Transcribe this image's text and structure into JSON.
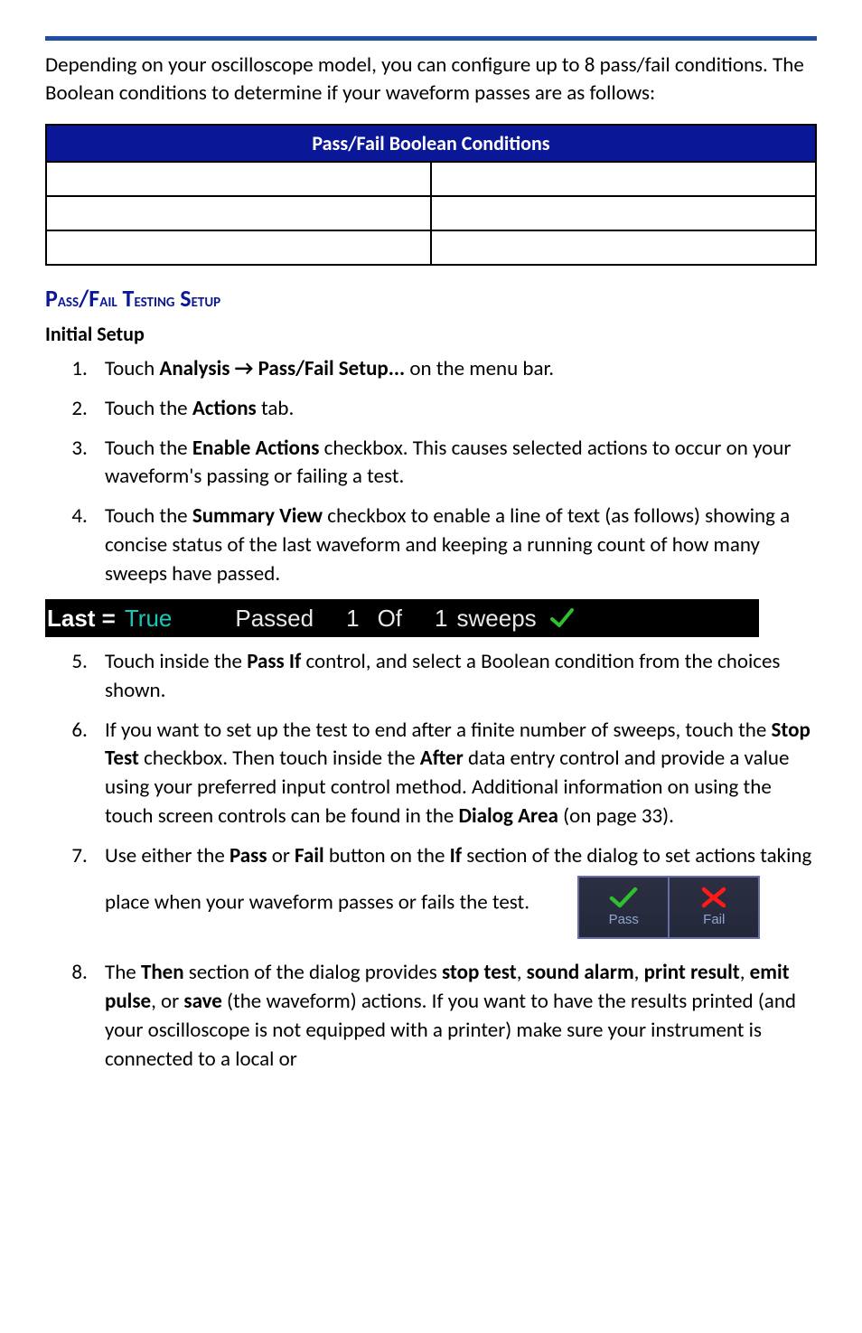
{
  "intro": "Depending on your oscilloscope model, you can configure up to 8 pass/fail conditions. The Boolean conditions to determine if your waveform passes are as follows:",
  "table": {
    "header": "Pass/Fail Boolean Conditions"
  },
  "section_heading_prefix": "P",
  "section_heading_rest1": "ass",
  "section_heading_rest2": "/F",
  "section_heading_rest3": "ail",
  "section_heading_rest4": " T",
  "section_heading_rest5": "esting",
  "section_heading_rest6": " S",
  "section_heading_rest7": "etup",
  "section_heading": "Pass/Fail Testing Setup",
  "subheading": "Initial Setup",
  "steps": {
    "s1_a": "Touch ",
    "s1_b": "Analysis → Pass/Fail Setup...",
    "s1_c": " on the menu bar.",
    "s2_a": "Touch the ",
    "s2_b": "Actions",
    "s2_c": " tab.",
    "s3_a": "Touch the ",
    "s3_b": "Enable Actions",
    "s3_c": " checkbox. This causes selected actions to occur on your waveform's passing or failing a test.",
    "s4_a": "Touch the ",
    "s4_b": "Summary View",
    "s4_c": " checkbox to enable a line of text (as follows) showing a concise status of the last waveform and keeping a running count of how many sweeps have passed.",
    "s5_a": "Touch inside the ",
    "s5_b": "Pass If",
    "s5_c": " control, and select a Boolean condition from the choices shown.",
    "s6_a": "If you want to set up the test to end after a finite number of sweeps, touch the ",
    "s6_b": "Stop Test",
    "s6_c": " checkbox. Then touch inside the ",
    "s6_d": "After",
    "s6_e": " data entry control and provide a value using your preferred input control method. Additional information on using the touch screen controls can be found in the ",
    "s6_f": "Dialog Area",
    "s6_g": " (on page 33).",
    "s7_a": "Use either the ",
    "s7_b": "Pass",
    "s7_c": " or ",
    "s7_d": "Fail",
    "s7_e": " button on the ",
    "s7_f": "If",
    "s7_g": " section of the dialog to set actions taking place when your waveform passes or fails the test.",
    "s8_a": "The ",
    "s8_b": "Then",
    "s8_c": " section of the dialog provides ",
    "s8_d": "stop test",
    "s8_e": ", ",
    "s8_f": "sound alarm",
    "s8_g": ", ",
    "s8_h": "print result",
    "s8_i": ", ",
    "s8_j": "emit pulse",
    "s8_k": ", or ",
    "s8_l": "save",
    "s8_m": " (the waveform) actions. If you want to have the results printed (and your oscilloscope is not equipped with a printer) make sure your instrument is connected to a local or"
  },
  "summary_bar": {
    "last_label": "Last =",
    "last_value": "True",
    "passed_label": "Passed",
    "count_a": "1",
    "of_label": "Of",
    "count_b": "1",
    "sweeps_label": "sweeps"
  },
  "passfail_buttons": {
    "pass": "Pass",
    "fail": "Fail"
  }
}
